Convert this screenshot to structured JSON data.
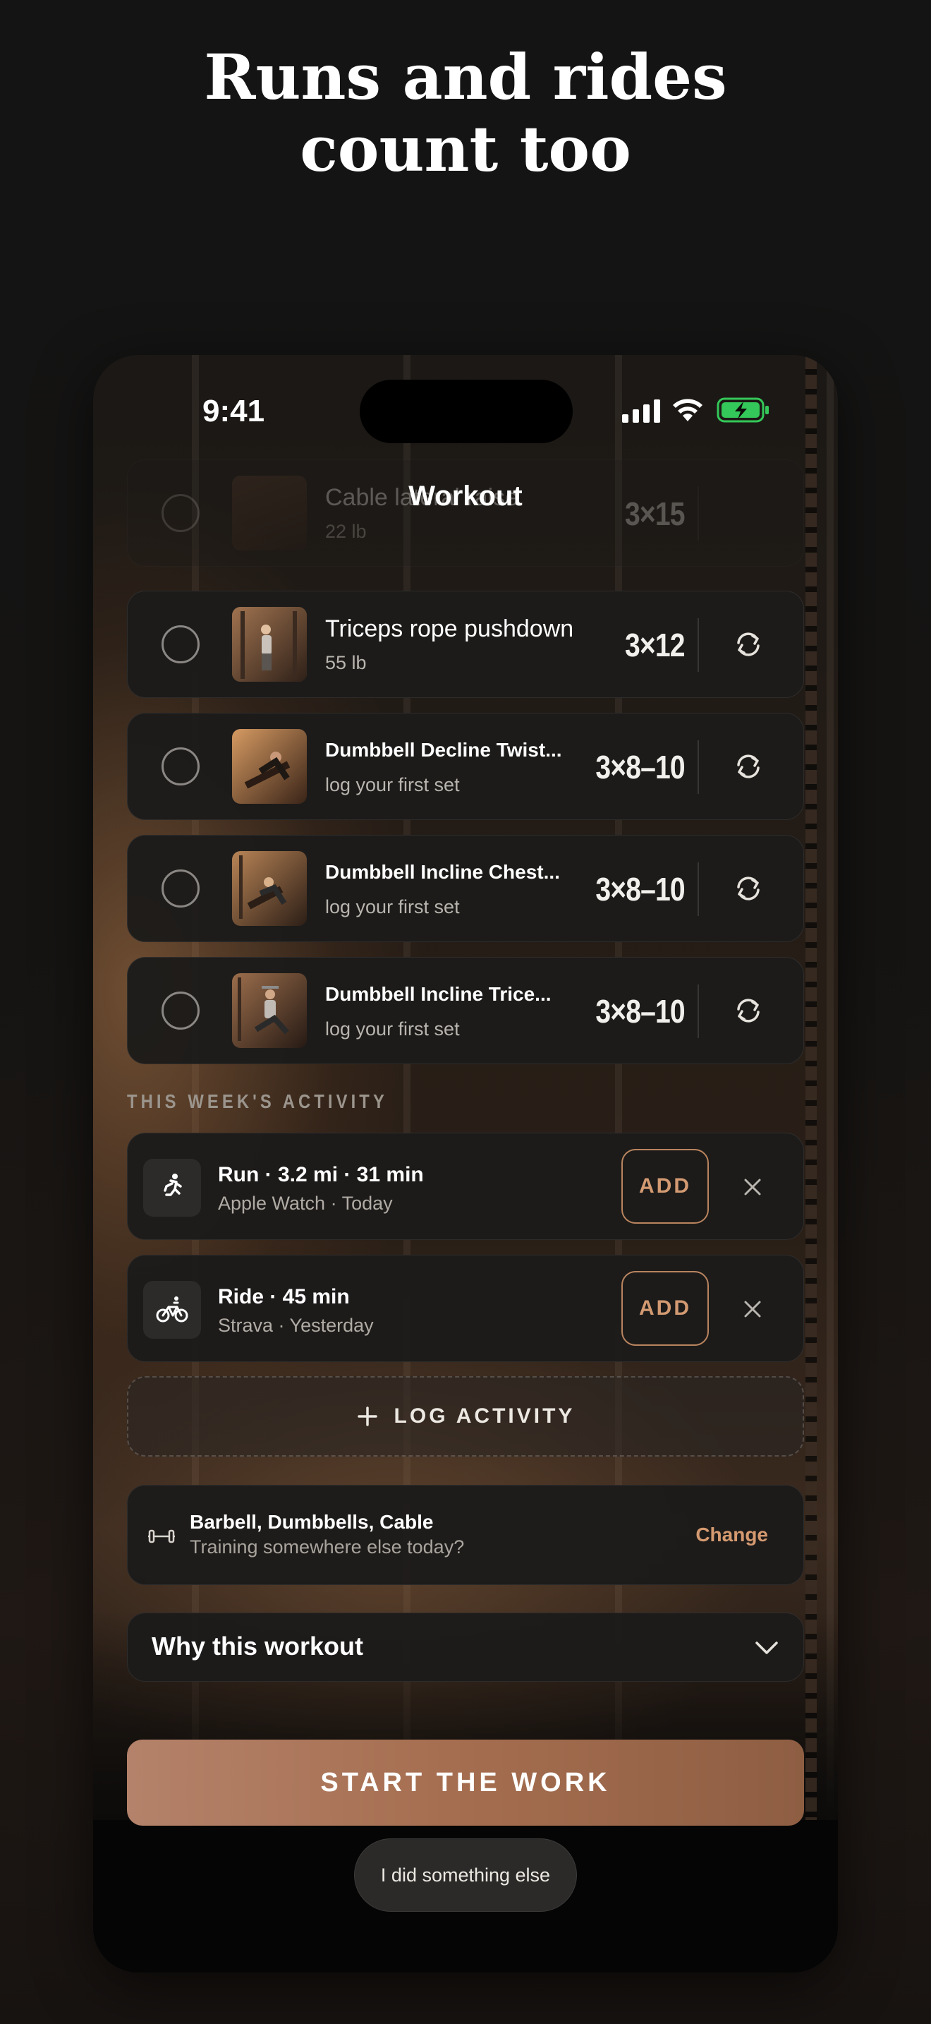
{
  "headline": {
    "line1": "Runs and rides",
    "line2": "count too"
  },
  "status_bar": {
    "time": "9:41"
  },
  "nav": {
    "title": "Workout"
  },
  "exercises": [
    {
      "name": "Cable lateral raise",
      "detail": "22 lb",
      "scheme": "3×15",
      "faded": true
    },
    {
      "name": "Triceps rope pushdown",
      "detail": "55 lb",
      "scheme": "3×12"
    },
    {
      "name": "Dumbbell Decline Twist...",
      "detail": "log your first set",
      "scheme": "3×8–10"
    },
    {
      "name": "Dumbbell Incline Chest...",
      "detail": "log your first set",
      "scheme": "3×8–10"
    },
    {
      "name": "Dumbbell Incline Trice...",
      "detail": "log your first set",
      "scheme": "3×8–10"
    }
  ],
  "activity": {
    "section_label": "THIS WEEK'S ACTIVITY",
    "items": [
      {
        "icon": "run-icon",
        "title": "Run · 3.2 mi · 31 min",
        "source": "Apple Watch · Today",
        "add_label": "ADD"
      },
      {
        "icon": "bike-icon",
        "title": "Ride · 45 min",
        "source": "Strava · Yesterday",
        "add_label": "ADD"
      }
    ],
    "log_label": "LOG ACTIVITY"
  },
  "equipment": {
    "title": "Barbell, Dumbbells, Cable",
    "subtitle": "Training somewhere else today?",
    "change_label": "Change"
  },
  "why": {
    "label": "Why this workout"
  },
  "actions": {
    "start_label": "START THE WORK",
    "else_label": "I did something else"
  },
  "colors": {
    "accent": "#b9845f",
    "accent_text": "#d39a72",
    "card": "#1c1b1a",
    "start_gradient_from": "#b4826a",
    "start_gradient_to": "#8e5e43"
  }
}
